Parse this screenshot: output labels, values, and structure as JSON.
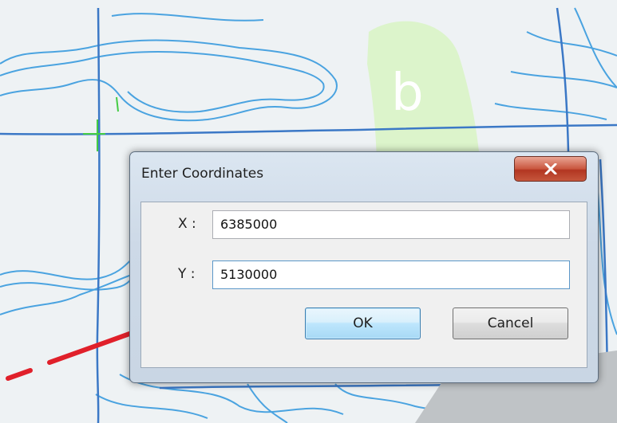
{
  "dialog": {
    "title": "Enter Coordinates",
    "close_glyph": "close-x-icon"
  },
  "fields": {
    "x_label": "X :",
    "x_value": "6385000",
    "y_label": "Y :",
    "y_value": "5130000"
  },
  "buttons": {
    "ok_label": "OK",
    "cancel_label": "Cancel"
  },
  "map": {
    "annotation_letter": "b"
  },
  "colors": {
    "map_background": "#eef2f4",
    "boundary_line": "#3b78c6",
    "contour_line": "#4aa3e0",
    "road_line": "#e0202a",
    "green_area": "#d8f5c3",
    "close_button": "#c45a44",
    "ok_button_border": "#3c7fb1"
  }
}
